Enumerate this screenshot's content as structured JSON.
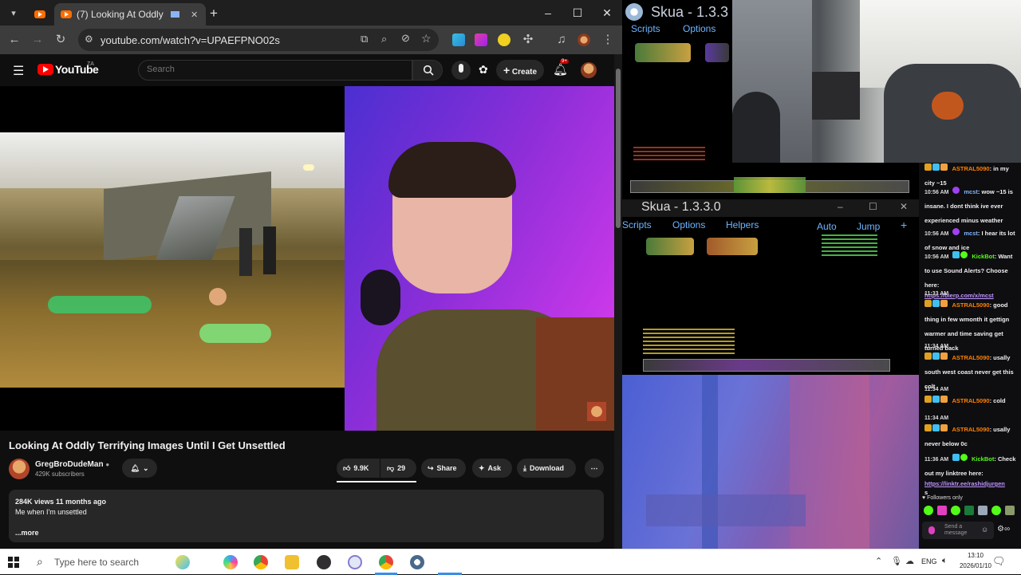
{
  "browser": {
    "tabs": [
      {
        "label": ""
      },
      {
        "label": "(7) Looking At Oddly Terrifyin"
      }
    ],
    "new_tab_glyph": "+",
    "url": "youtube.com/watch?v=UPAEFPNO02s",
    "controls": {
      "minimize": "–",
      "maximize": "☐",
      "close": "✕"
    }
  },
  "youtube": {
    "logo_text": "YouTube",
    "country_code": "ZA",
    "search_placeholder": "Search",
    "create_label": "Create",
    "notification_count": "9+",
    "video": {
      "title": "Looking At Oddly Terrifying Images Until I Get Unsettled",
      "channel_name": "GregBroDudeMan",
      "subscribers": "429K subscribers",
      "likes": "9.9K",
      "dislikes": "29",
      "share_label": "Share",
      "ask_label": "Ask",
      "download_label": "Download",
      "views_date": "284K views  11 months ago",
      "description": "Me when I'm unsettled",
      "more_label": "...more"
    }
  },
  "skua_top": {
    "title": "Skua - 1.3.3",
    "menu": [
      "Scripts",
      "Options"
    ]
  },
  "skua_bottom": {
    "title": "Skua - 1.3.3.0",
    "menu": [
      "Scripts",
      "Options",
      "Helpers"
    ],
    "right_menu": [
      "Auto",
      "Jump"
    ],
    "plus": "+"
  },
  "chat": {
    "messages": [
      {
        "time": "",
        "user": "ASTRAL5090",
        "user_color": "#ff7f00",
        "text": "in my city ~15"
      },
      {
        "time": "10:56 AM",
        "user": "mcst",
        "user_color": "#7fb4ff",
        "text": "wow ~15 is insane. I dont think ive ever experienced minus weather"
      },
      {
        "time": "10:56 AM",
        "user": "mcst",
        "user_color": "#7fb4ff",
        "text": "I hear its lot of snow and ice"
      },
      {
        "time": "10:56 AM",
        "user": "KickBot",
        "user_color": "#53fc18",
        "text": "Want to use Sound Alerts? Choose here:",
        "link": "https://bierp.com/x/mcst"
      },
      {
        "time": "11:33 AM",
        "user": "ASTRAL5090",
        "user_color": "#ff7f00",
        "text": "good thing in few wmonth it gettign warmer and time saving get turned back"
      },
      {
        "time": "11:34 AM",
        "user": "ASTRAL5090",
        "user_color": "#ff7f00",
        "text": "usally south west coast never get this colt"
      },
      {
        "time": "11:34 AM",
        "user": "ASTRAL5090",
        "user_color": "#ff7f00",
        "text": "cold"
      },
      {
        "time": "11:34 AM",
        "user": "ASTRAL5090",
        "user_color": "#ff7f00",
        "text": "usally never below 0c"
      },
      {
        "time": "11:36 AM",
        "user": "KickBot",
        "user_color": "#53fc18",
        "text": "Check out my linktree here:",
        "link": "https://linktr.ee/rashidjurgen",
        "after": "s"
      }
    ],
    "followers_only": "Followers only",
    "send_placeholder": "Send a message"
  },
  "taskbar": {
    "search_placeholder": "Type here to search",
    "language": "ENG",
    "time": "13:10",
    "date": "2026/01/10"
  },
  "colors": {
    "youtube_red": "#ff0000",
    "kick_green": "#53fc18",
    "astral_orange": "#ff7f00",
    "mcst_blue": "#7fb4ff"
  }
}
